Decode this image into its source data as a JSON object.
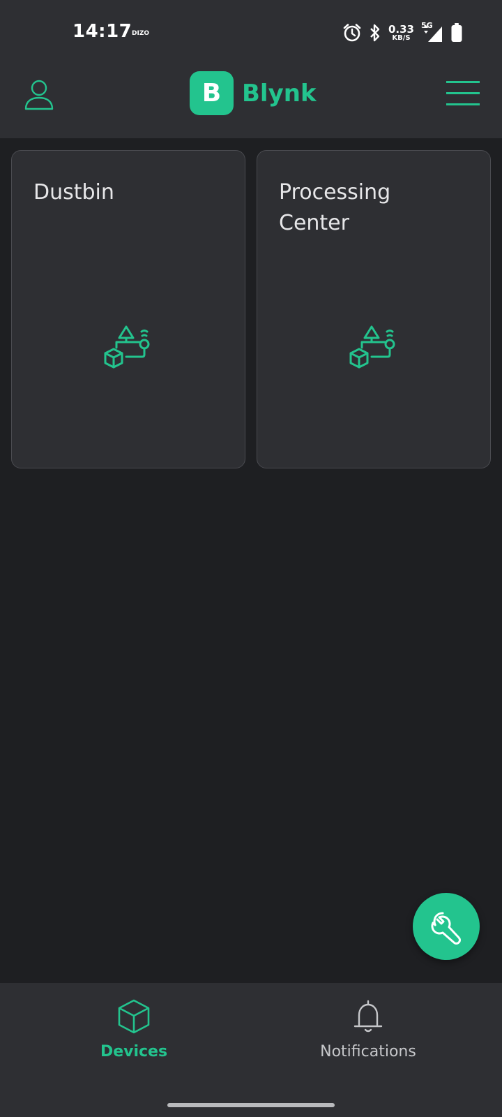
{
  "status_bar": {
    "time": "14:17",
    "carrier": "DIZO",
    "net_speed_value": "0.33",
    "net_speed_unit": "KB/S",
    "network_type": "5G",
    "icons": [
      "alarm-icon",
      "bluetooth-icon",
      "signal-icon",
      "battery-icon"
    ]
  },
  "header": {
    "logo_letter": "B",
    "logo_text": "Blynk"
  },
  "devices": [
    {
      "name": "Dustbin",
      "icon": "device-iot-icon"
    },
    {
      "name": "Processing Center",
      "icon": "device-iot-icon"
    }
  ],
  "fab": {
    "icon": "wrench-icon"
  },
  "bottom_nav": {
    "items": [
      {
        "label": "Devices",
        "icon": "cube-icon",
        "active": true
      },
      {
        "label": "Notifications",
        "icon": "bell-icon",
        "active": false
      }
    ]
  },
  "colors": {
    "accent": "#23c48e",
    "background": "#1e1f22",
    "surface": "#2e2f33",
    "card_border": "#4a4b50"
  }
}
